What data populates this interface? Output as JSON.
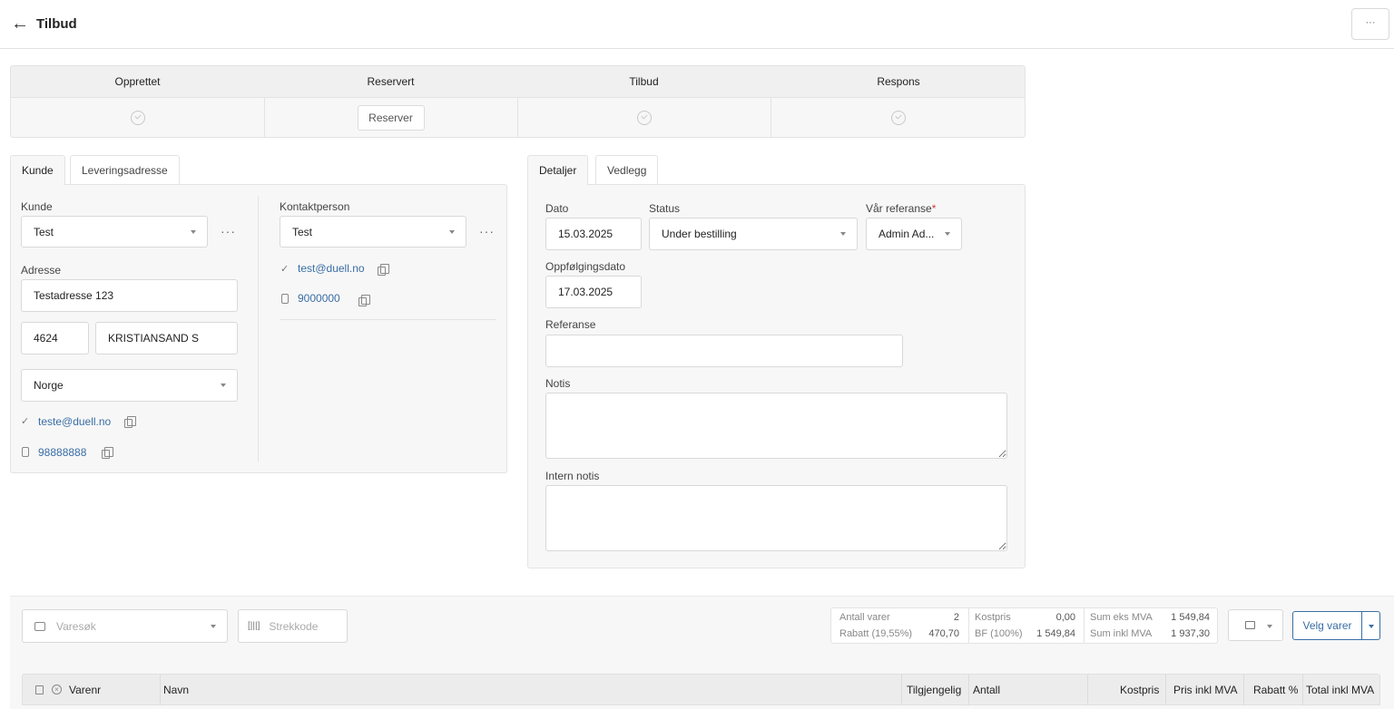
{
  "header": {
    "title": "Tilbud",
    "more_label": "···"
  },
  "steps": [
    {
      "label": "Opprettet"
    },
    {
      "label": "Reservert",
      "button_label": "Reserver"
    },
    {
      "label": "Tilbud"
    },
    {
      "label": "Respons"
    }
  ],
  "left_tabs": [
    "Kunde",
    "Leveringsadresse"
  ],
  "customer": {
    "customer_label": "Kunde",
    "customer_value": "Test",
    "address_label": "Adresse",
    "address_value": "Testadresse 123",
    "postal_code": "4624",
    "city": "KRISTIANSAND S",
    "country": "Norge",
    "email": "teste@duell.no",
    "phone": "98888888",
    "contact_label": "Kontaktperson",
    "contact_value": "Test",
    "contact_email": "test@duell.no",
    "contact_phone": "9000000"
  },
  "right_tabs": [
    "Detaljer",
    "Vedlegg"
  ],
  "details": {
    "date_label": "Dato",
    "date_value": "15.03.2025",
    "status_label": "Status",
    "status_value": "Under bestilling",
    "our_ref_label": "Vår referanse",
    "required_mark": "*",
    "our_ref_value": "Admin Ad...",
    "followup_label": "Oppfølgingsdato",
    "followup_value": "17.03.2025",
    "reference_label": "Referanse",
    "reference_value": "",
    "note_label": "Notis",
    "note_value": "",
    "internal_note_label": "Intern notis",
    "internal_note_value": ""
  },
  "items_toolbar": {
    "search_placeholder": "Varesøk",
    "barcode_placeholder": "Strekkode",
    "stats": {
      "antall_label": "Antall varer",
      "antall_value": "2",
      "kostpris_label": "Kostpris",
      "kostpris_value": "0,00",
      "sum_eks_label": "Sum eks MVA",
      "sum_eks_value": "1 549,84",
      "rabatt_label": "Rabatt (19,55%)",
      "rabatt_value": "470,70",
      "bf_label": "BF (100%)",
      "bf_value": "1 549,84",
      "sum_inkl_label": "Sum inkl MVA",
      "sum_inkl_value": "1 937,30"
    },
    "velg_label": "Velg varer"
  },
  "table": {
    "columns": [
      "Varenr",
      "Navn",
      "Tilgjengelig",
      "Antall",
      "Kostpris",
      "Pris inkl MVA",
      "Rabatt %",
      "Total inkl MVA"
    ]
  }
}
